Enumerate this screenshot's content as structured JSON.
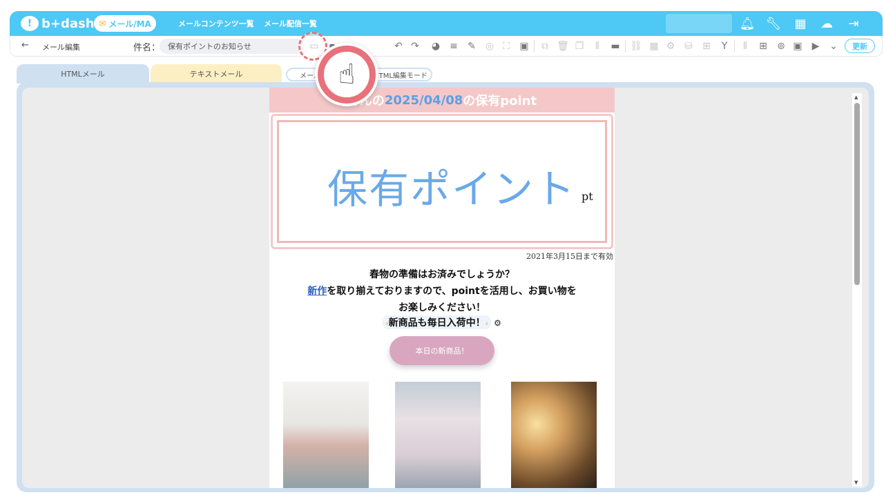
{
  "app": {
    "logo_text": "b+dash",
    "module_label": "メール/MA"
  },
  "nav": {
    "contents_list": "メールコンテンツ一覧",
    "delivery_list": "メール配信一覧"
  },
  "top_icons": [
    "bell-icon",
    "wrench-icon",
    "grid-icon",
    "chat-icon",
    "logout-icon"
  ],
  "editbar": {
    "back_label": "メール編集",
    "subject_label": "件名：",
    "subject_value": "保有ポイントのお知らせ",
    "update_label": "更新"
  },
  "tabs": {
    "html": "HTMLメール",
    "text": "テキストメール",
    "mail_settings": "メール設定",
    "html_edit_mode": "HTML編集モード"
  },
  "mail": {
    "header_prefix": "さんの",
    "header_date": "2025/04/08",
    "header_suffix": "の保有point",
    "point_title": "保有ポイント",
    "point_unit": "pt",
    "validity": "2021年3月15日まで有効",
    "line1": "春物の準備はお済みでしょうか？",
    "line2_link": "新作",
    "line2_rest": "を取り揃えておりますので、pointを活用し、お買い物を",
    "line3": "お楽しみください！",
    "line4": "新商品も毎日入荷中！",
    "button": "本日の新商品！"
  },
  "colors": {
    "brand": "#4ec8f4",
    "accent": "#e8717b",
    "pink": "#f4c8c8",
    "point_blue": "#6aa9e8",
    "button": "#d9a6c0"
  }
}
